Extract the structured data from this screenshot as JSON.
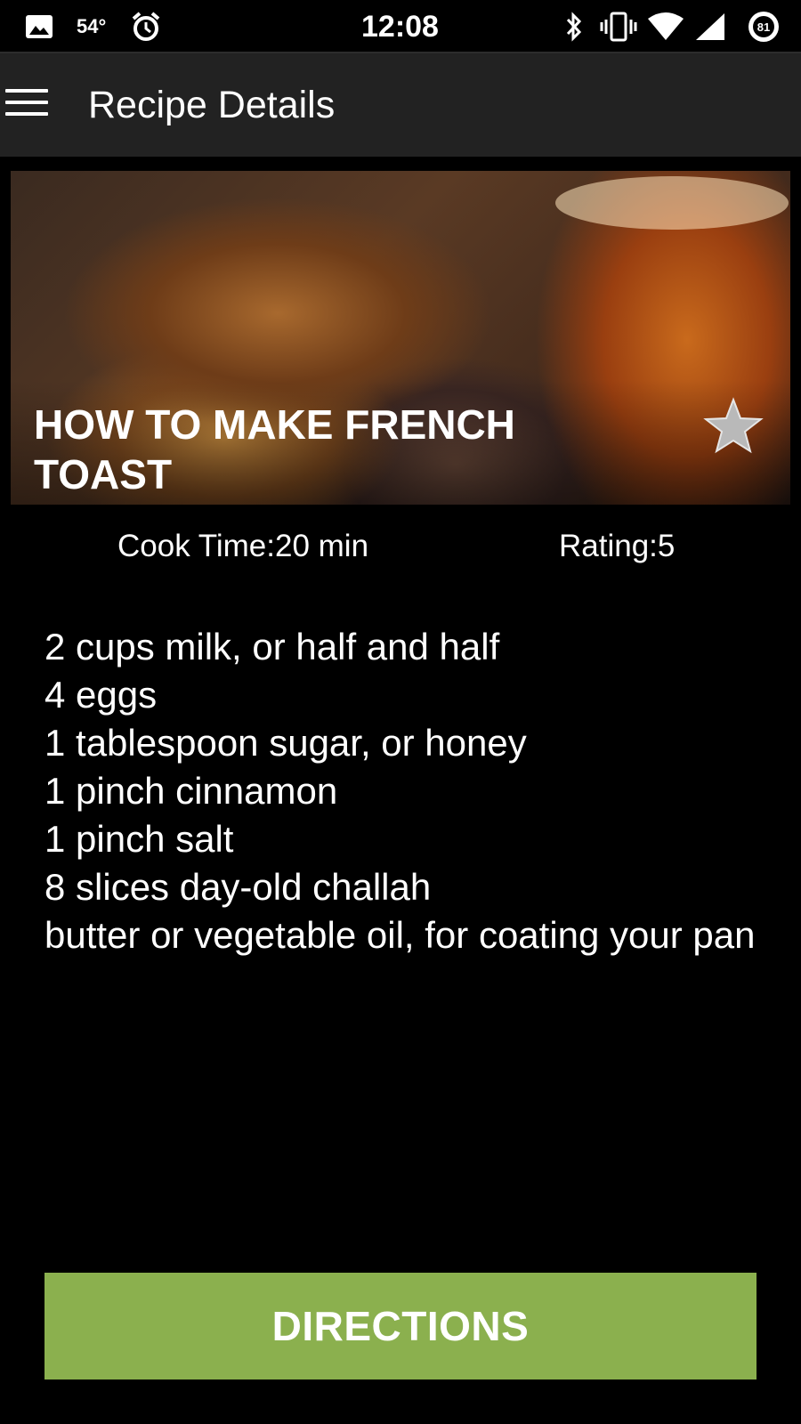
{
  "status_bar": {
    "temperature": "54°",
    "time": "12:08",
    "battery": "81",
    "icons": [
      "image-icon",
      "alarm-clock-icon",
      "bluetooth-icon",
      "vibrate-icon",
      "wifi-icon",
      "cell-signal-icon",
      "battery-icon"
    ]
  },
  "app_bar": {
    "title": "Recipe Details",
    "menu_icon": "hamburger-menu-icon"
  },
  "recipe": {
    "title": "HOW TO MAKE FRENCH TOAST",
    "favorite_icon": "star-icon",
    "cook_time": "Cook Time:20 min",
    "rating": "Rating:5",
    "ingredients": [
      "2 cups milk, or half and half",
      "4 eggs",
      "1 tablespoon sugar, or honey",
      "1 pinch cinnamon",
      "1 pinch salt",
      "8 slices day-old challah",
      "butter or vegetable oil, for coating your pan"
    ]
  },
  "actions": {
    "directions_label": "DIRECTIONS"
  },
  "colors": {
    "app_bar": "#222222",
    "background": "#000000",
    "button": "#8bb04e",
    "text": "#ffffff"
  }
}
